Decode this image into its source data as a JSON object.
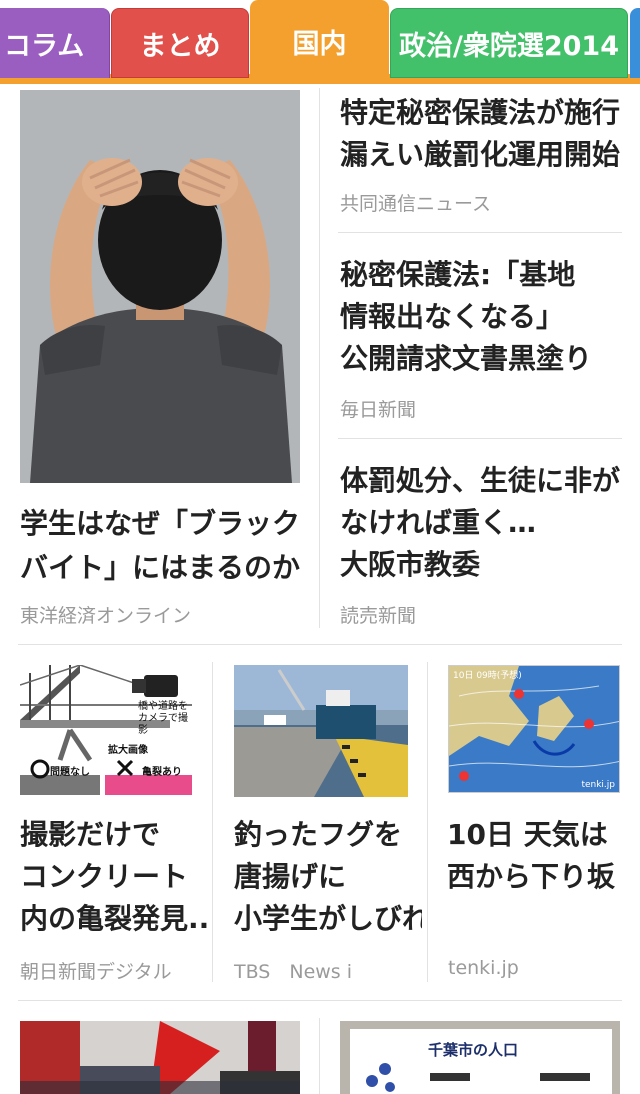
{
  "tabs": [
    {
      "label": "コラム"
    },
    {
      "label": "まとめ"
    },
    {
      "label": "国内"
    },
    {
      "label": "政治/衆院選2014"
    }
  ],
  "colors": {
    "tab_column": "#9a5ec0",
    "tab_matome": "#e2504c",
    "tab_domestic": "#f3a02f",
    "tab_politics": "#43c06a",
    "tab_next": "#3a8fdb",
    "source_text": "#9a9a9a"
  },
  "feature": {
    "title_lines": [
      "学生はなぜ「ブラック",
      "バイト」にはまるのか"
    ],
    "source": "東洋経済オンライン",
    "image_icon": "stressed-man-photo"
  },
  "right_articles": [
    {
      "title_lines": [
        "特定秘密保護法が施行",
        "漏えい厳罰化運用開始"
      ],
      "source": "共同通信ニュース"
    },
    {
      "title_lines": [
        "秘密保護法:「基地",
        "情報出なくなる」",
        "公開請求文書黒塗り"
      ],
      "source": "毎日新聞"
    },
    {
      "title_lines": [
        "体罰処分、生徒に非が",
        "なければ重く…",
        "大阪市教委"
      ],
      "source": "読売新聞"
    }
  ],
  "grid_articles": [
    {
      "title_lines": [
        "撮影だけで",
        "コンクリート",
        "内の亀裂発見..."
      ],
      "source": "朝日新聞デジタル",
      "image_labels": {
        "line1": "橋や道路を",
        "line2": "カメラで撮影",
        "zoom": "拡大画像",
        "ok": "問題なし",
        "ng": "亀裂あり"
      }
    },
    {
      "title_lines": [
        "釣ったフグを",
        "唐揚げに",
        "小学生がしびれ..."
      ],
      "source": "TBS　News i"
    },
    {
      "title_lines": [
        "10日 天気は",
        "西から下り坂"
      ],
      "source": "tenki.jp",
      "image_labels": {
        "header": "10日 09時(予想)",
        "brand": "tenki.jp"
      }
    }
  ],
  "bottom_articles": [
    {
      "image_icon": "protest-photo"
    },
    {
      "image_labels": {
        "sign": "千葉市の人口"
      }
    }
  ]
}
